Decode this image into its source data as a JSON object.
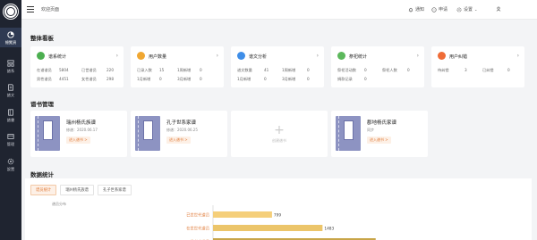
{
  "sidebar": {
    "items": [
      {
        "label": "總覽頁",
        "icon": "dashboard-icon",
        "active": true
      },
      {
        "label": "譜系",
        "icon": "tree-icon",
        "active": false
      },
      {
        "label": "譜文",
        "icon": "document-icon",
        "active": false
      },
      {
        "label": "譜書",
        "icon": "book-icon",
        "active": false
      },
      {
        "label": "管理",
        "icon": "manage-icon",
        "active": false
      },
      {
        "label": "設置",
        "icon": "settings-icon",
        "active": false
      }
    ]
  },
  "topbar": {
    "breadcrumb": "欢迎页面",
    "notify": "通知",
    "feedback": "申请",
    "settings": "设置"
  },
  "overview": {
    "title": "整体看板",
    "cards": [
      {
        "title": "谱系统计",
        "icon": "people-icon",
        "color": "#4caf50",
        "rows": [
          [
            "在谱谱员",
            "5804",
            "已世谱员",
            "220"
          ],
          [
            "男性谱员",
            "4451",
            "女性谱员",
            "298"
          ]
        ]
      },
      {
        "title": "用户数量",
        "icon": "user-icon",
        "color": "#f0a732",
        "rows": [
          [
            "已录入数",
            "15",
            "1周新增",
            "0"
          ],
          [
            "1月新增",
            "0",
            "3月新增",
            "0"
          ]
        ]
      },
      {
        "title": "谱文分析",
        "icon": "text-icon",
        "color": "#3f8ee8",
        "rows": [
          [
            "谱文数量",
            "41",
            "1周新增",
            "0"
          ],
          [
            "1月新增",
            "0",
            "3月新增",
            "0"
          ]
        ]
      },
      {
        "title": "祭祀统计",
        "icon": "incense-icon",
        "color": "#5cb85c",
        "rows": [
          [
            "祭祀活动数",
            "0",
            "祭祀人数",
            "0"
          ],
          [
            "捐款记录",
            "0",
            "",
            ""
          ]
        ]
      },
      {
        "title": "用户纠错",
        "icon": "edit-icon",
        "color": "#ef6c37",
        "rows": [
          [
            "待纠错",
            "3",
            "已纠错",
            "0"
          ]
        ]
      }
    ]
  },
  "books_section": {
    "title": "谱书管理",
    "books": [
      {
        "name": "瑞州杨氏族谱",
        "date": "修谱：2020.06.17",
        "enter": "进入谱书 >"
      },
      {
        "name": "孔子世系家谱",
        "date": "修谱：2020.06.25",
        "enter": "进入谱书 >"
      },
      {
        "name": "郡地杨氏家谱",
        "date": "同步",
        "enter": "进入谱书 >"
      }
    ],
    "add_label": "创建谱书"
  },
  "stats": {
    "title": "数据统计",
    "tabs": [
      "谱员统计",
      "瑞州杨氏族谱",
      "孔子世系家谱"
    ],
    "active_tab": 0,
    "subtitle": "谱员分布"
  },
  "chart_data": {
    "type": "bar",
    "orientation": "horizontal",
    "categories": [
      "已世世代谱员",
      "在世世代谱员",
      "谱书内谱员"
    ],
    "values": [
      799,
      1483,
      2203
    ],
    "colors": [
      "#f5cf7a",
      "#ecc56a",
      "#c8a548"
    ],
    "xlim": [
      0,
      4000
    ]
  }
}
